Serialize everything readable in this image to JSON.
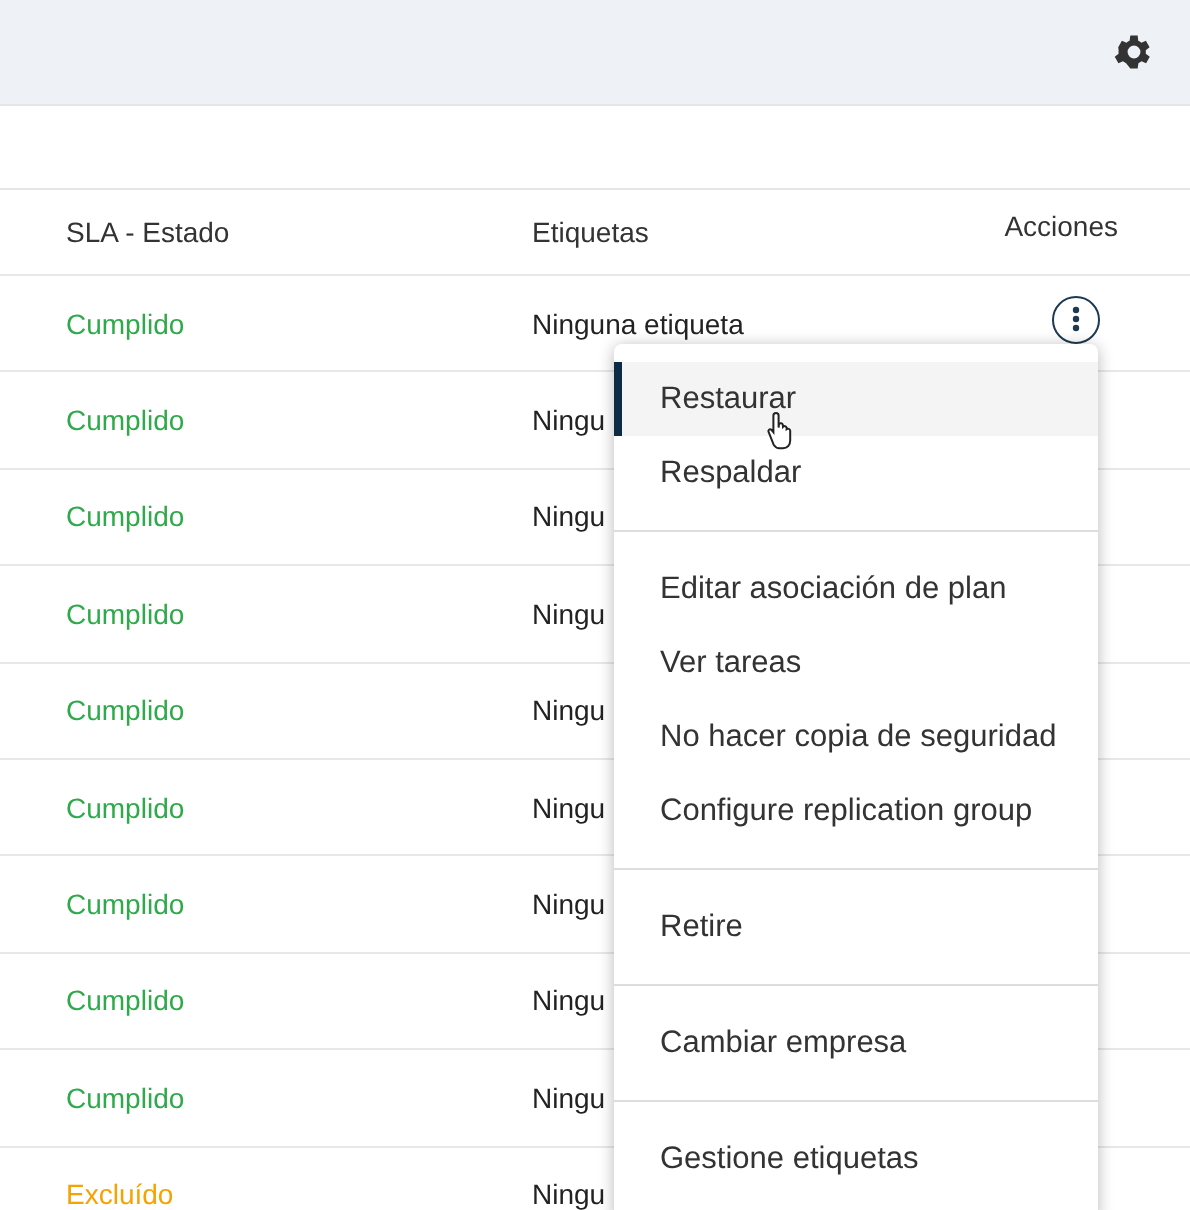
{
  "table": {
    "columns": [
      "SLA - Estado",
      "Etiquetas",
      "Acciones"
    ],
    "rows": [
      {
        "sla": "Cumplido",
        "color": "#2eaa4a",
        "tags": "Ninguna etiqueta",
        "actions_button": true
      },
      {
        "sla": "Cumplido",
        "color": "#2eaa4a",
        "tags": "Ningu",
        "actions_button": false
      },
      {
        "sla": "Cumplido",
        "color": "#2eaa4a",
        "tags": "Ningu",
        "actions_button": false
      },
      {
        "sla": "Cumplido",
        "color": "#2eaa4a",
        "tags": "Ningu",
        "actions_button": false
      },
      {
        "sla": "Cumplido",
        "color": "#2eaa4a",
        "tags": "Ningu",
        "actions_button": false
      },
      {
        "sla": "Cumplido",
        "color": "#2eaa4a",
        "tags": "Ningu",
        "actions_button": false
      },
      {
        "sla": "Cumplido",
        "color": "#2eaa4a",
        "tags": "Ningu",
        "actions_button": false
      },
      {
        "sla": "Cumplido",
        "color": "#2eaa4a",
        "tags": "Ningu",
        "actions_button": false
      },
      {
        "sla": "Cumplido",
        "color": "#2eaa4a",
        "tags": "Ningu",
        "actions_button": false
      },
      {
        "sla": "Excluído",
        "color": "#f5a300",
        "tags": "Ningu",
        "actions_button": false
      }
    ]
  },
  "context_menu": {
    "groups": [
      [
        {
          "label": "Restaurar",
          "selected": true
        },
        {
          "label": "Respaldar",
          "selected": false
        }
      ],
      [
        {
          "label": "Editar asociación de plan",
          "selected": false
        },
        {
          "label": "Ver tareas",
          "selected": false
        },
        {
          "label": "No hacer copia de seguridad",
          "selected": false
        },
        {
          "label": "Configure replication group",
          "selected": false
        }
      ],
      [
        {
          "label": "Retire",
          "selected": false
        }
      ],
      [
        {
          "label": "Cambiar empresa",
          "selected": false
        }
      ],
      [
        {
          "label": "Gestione etiquetas",
          "selected": false
        }
      ]
    ]
  }
}
